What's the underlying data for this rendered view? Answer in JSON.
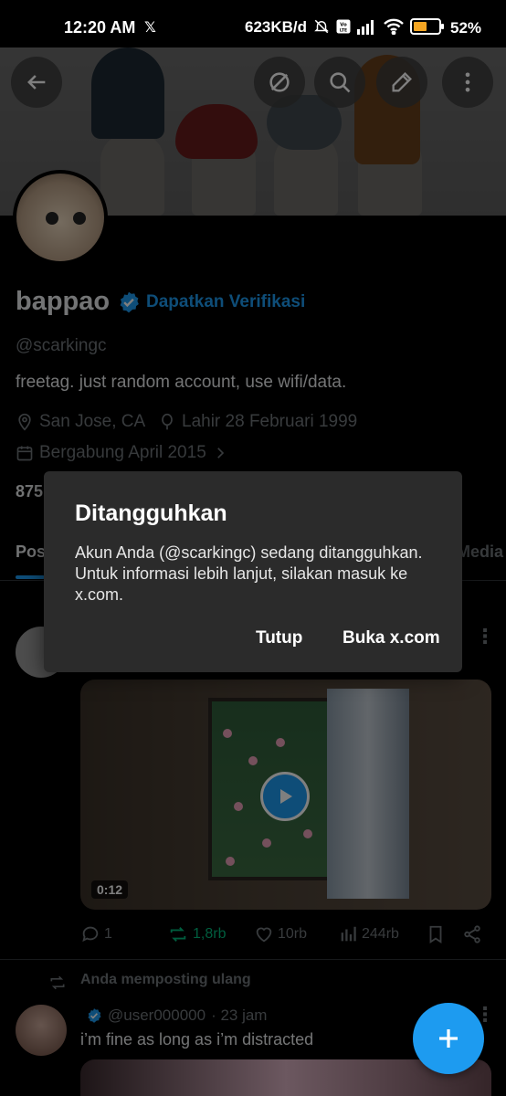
{
  "status_bar": {
    "time": "12:20 AM",
    "notif_icon": "x-logo",
    "network_speed": "623KB/d",
    "icons": [
      "mute-bell-icon",
      "volte-icon",
      "signal-icon",
      "wifi-icon",
      "battery-icon"
    ],
    "battery": "52%",
    "battery_level": 0.52
  },
  "header": {
    "back_icon": "arrow-left-icon",
    "grok_icon": "grok-icon",
    "search_icon": "search-icon",
    "compose_icon": "pencil-icon",
    "more_icon": "more-vertical-icon"
  },
  "profile": {
    "name": "bappao",
    "verified_badge": "verified-badge-icon",
    "get_verified": "Dapatkan Verifikasi",
    "handle": "@scarkingc",
    "bio": "freetag. just random account, use wifi/data.",
    "location": "San Jose, CA",
    "birthday": "Lahir 28 Februari 1999",
    "joined": "Bergabung April 2015",
    "following_count": "875"
  },
  "tabs": {
    "posts": "Pos",
    "media": "Media"
  },
  "post1": {
    "video_duration": "0:12",
    "replies": "1",
    "reposts": "1,8rb",
    "likes": "10rb",
    "views": "244rb"
  },
  "post2": {
    "repost_label": "Anda memposting ulang",
    "user": "@user000000",
    "time": "· 23 jam",
    "text": "i’m fine as long as i’m distracted"
  },
  "dialog": {
    "title": "Ditangguhkan",
    "body": "Akun Anda (@scarkingc) sedang ditangguhkan. Untuk informasi lebih lanjut, silakan masuk ke x.com.",
    "close_button": "Tutup",
    "open_button": "Buka x.com"
  },
  "colors": {
    "accent": "#1d9bf0",
    "repost_green": "#00ba7c",
    "dialog_bg": "#2b2b2b"
  }
}
